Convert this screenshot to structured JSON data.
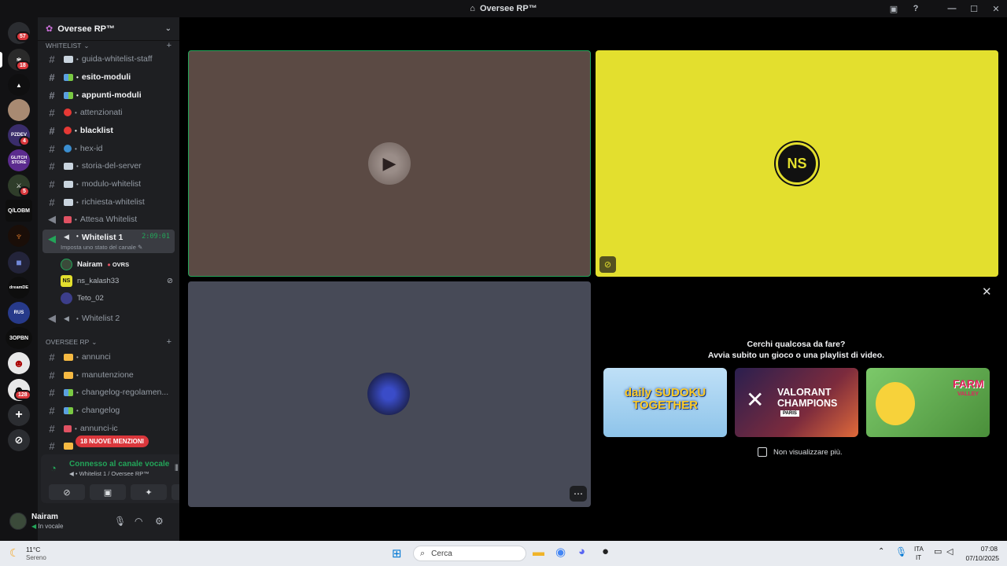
{
  "window": {
    "title": "Oversee RP™"
  },
  "rail": {
    "servers": [
      {
        "name": "dm",
        "badge": "57"
      },
      {
        "name": "server-2",
        "badge": "18"
      },
      {
        "name": "server-3",
        "badge": ""
      },
      {
        "name": "server-4",
        "badge": ""
      },
      {
        "name": "pzdev",
        "label": "PZDEV",
        "badge": "4"
      },
      {
        "name": "glitch-store",
        "label": "GLITCH STORE",
        "badge": ""
      },
      {
        "name": "server-7",
        "badge": "5"
      },
      {
        "name": "lobm",
        "label": "Q/LOBM",
        "badge": ""
      },
      {
        "name": "server-9",
        "badge": ""
      },
      {
        "name": "folder",
        "badge": ""
      },
      {
        "name": "dreamdev",
        "label": "dreamDE",
        "badge": ""
      },
      {
        "name": "rus",
        "label": "RUS",
        "badge": ""
      },
      {
        "name": "bopbn",
        "label": "3OPBN",
        "badge": ""
      },
      {
        "name": "server-14",
        "badge": ""
      },
      {
        "name": "server-15",
        "badge": "128"
      }
    ]
  },
  "sidebar": {
    "guild_name": "Oversee RP™",
    "categories": {
      "whitelist": "WHITELIST",
      "oversee": "OVERSEE RP"
    },
    "channels": [
      {
        "name": "guida-whitelist-staff",
        "unread": false
      },
      {
        "name": "esito-moduli",
        "unread": true
      },
      {
        "name": "appunti-moduli",
        "unread": true
      },
      {
        "name": "attenzionati",
        "unread": false
      },
      {
        "name": "blacklist",
        "unread": true
      },
      {
        "name": "hex-id",
        "unread": false
      },
      {
        "name": "storia-del-server",
        "unread": false
      },
      {
        "name": "modulo-whitelist",
        "unread": false
      },
      {
        "name": "richiesta-whitelist",
        "unread": false
      },
      {
        "name": "Attesa Whitelist",
        "unread": false
      },
      {
        "name": "Whitelist 1",
        "active": true
      },
      {
        "name": "Whitelist 2",
        "unread": false
      }
    ],
    "oversee_channels": [
      {
        "name": "annunci"
      },
      {
        "name": "manutenzione"
      },
      {
        "name": "changelog-regolamen..."
      },
      {
        "name": "changelog"
      },
      {
        "name": "annunci-ic"
      },
      {
        "name": ""
      }
    ],
    "voice_timer": "2:09:01",
    "status_hint": "Imposta uno stato del canale",
    "voice_users": [
      {
        "name": "Nairam",
        "tag": "OVRS"
      },
      {
        "name": "ns_kalash33"
      },
      {
        "name": "Teto_02"
      }
    ],
    "mention_pill": "18 NUOVE MENZIONI"
  },
  "voice_panel": {
    "title": "Connesso al canale vocale",
    "subtitle": "Whitelist 1 / Oversee RP™"
  },
  "user_panel": {
    "name": "Nairam",
    "status": "In vocale"
  },
  "stage": {
    "promo_question": "Cerchi qualcosa da fare?",
    "promo_sub": "Avvia subito un gioco o una playlist di video.",
    "cards": [
      {
        "title": "daily SUDOKU TOGETHER"
      },
      {
        "title": "VALORANT CHAMPIONS",
        "subtitle": "PARIS"
      },
      {
        "title": "FARM",
        "subtitle": "VALLEY"
      }
    ],
    "checkbox_label": "Non visualizzare più.",
    "colors": {
      "tile1": "#5b4a44",
      "tile2": "#e3df2e",
      "tile3": "#474a57",
      "speaking": "#23a559"
    }
  },
  "taskbar": {
    "weather_temp": "11°C",
    "weather_text": "Sereno",
    "search": "Cerca",
    "lang_1": "ITA",
    "lang_2": "IT",
    "time": "07:08",
    "date": "07/10/2025"
  }
}
